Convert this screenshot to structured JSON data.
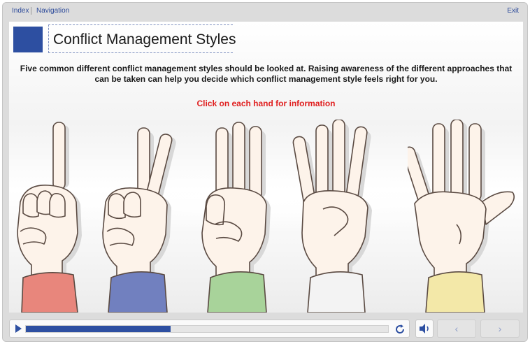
{
  "nav": {
    "index": "Index",
    "navigation": "Navigation",
    "exit": "Exit"
  },
  "title": "Conflict Management Styles",
  "intro": "Five common different conflict management styles should be looked at. Raising awareness of the different approaches that can be taken can help you decide which conflict management style feels right for you.",
  "instruction": "Click on each hand for information",
  "hands": [
    {
      "fingers": 1,
      "sleeve_color": "#e8867c"
    },
    {
      "fingers": 2,
      "sleeve_color": "#7180bf"
    },
    {
      "fingers": 3,
      "sleeve_color": "#a8d39a"
    },
    {
      "fingers": 4,
      "sleeve_color": "#f3f3f3"
    },
    {
      "fingers": 5,
      "sleeve_color": "#f3e8a8"
    }
  ],
  "player": {
    "progress_percent": 40
  },
  "icons": {
    "play": "play-icon",
    "replay": "replay-icon",
    "volume": "volume-icon",
    "previous": "chevron-left-icon",
    "next": "chevron-right-icon"
  },
  "colors": {
    "accent": "#2d4fa1",
    "instruction": "#e02020",
    "skin": "#fdf3ea"
  },
  "chevrons": {
    "previous": "‹",
    "next": "›"
  }
}
